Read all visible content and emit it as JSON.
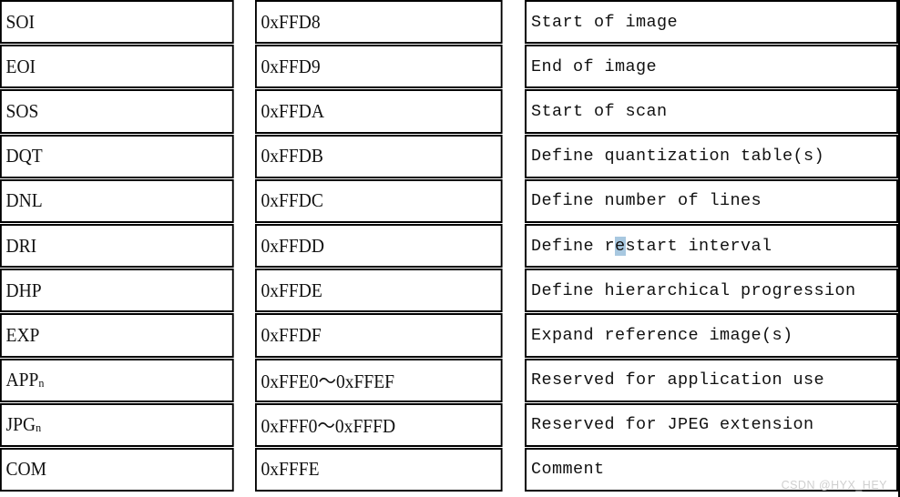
{
  "table": {
    "columns": [
      "symbol",
      "code",
      "description"
    ],
    "rows": [
      {
        "symbol": "SOI",
        "code": "0xFFD8",
        "description": "Start of image"
      },
      {
        "symbol": "EOI",
        "code": "0xFFD9",
        "description": "End of image"
      },
      {
        "symbol": "SOS",
        "code": "0xFFDA",
        "description": "Start of scan"
      },
      {
        "symbol": "DQT",
        "code": "0xFFDB",
        "description": "Define quantization table(s)"
      },
      {
        "symbol": "DNL",
        "code": "0xFFDC",
        "description": "Define number of lines"
      },
      {
        "symbol": "DRI",
        "code": "0xFFDD",
        "description": "Define restart interval",
        "description_pre": "Define r",
        "description_selected": "e",
        "description_post": "start interval",
        "has_selection": true
      },
      {
        "symbol": "DHP",
        "code": "0xFFDE",
        "description": "Define hierarchical progression"
      },
      {
        "symbol": "EXP",
        "code": "0xFFDF",
        "description": "Expand reference image(s)"
      },
      {
        "symbol": "APP",
        "symbol_sub": "n",
        "code": "0xFFE0〜0xFFEF",
        "description": "Reserved for application use"
      },
      {
        "symbol": "JPG",
        "symbol_sub": "n",
        "code": "0xFFF0〜0xFFFD",
        "description": "Reserved for JPEG extension"
      },
      {
        "symbol": "COM",
        "code": "0xFFFE",
        "description": "Comment"
      }
    ]
  },
  "watermark": {
    "text": "CSDN @HYX_HEY"
  },
  "colors": {
    "border": "#000000",
    "text": "#111111",
    "background": "#ffffff",
    "selection": "#a8c8e0",
    "watermark": "#cfcfcf"
  }
}
